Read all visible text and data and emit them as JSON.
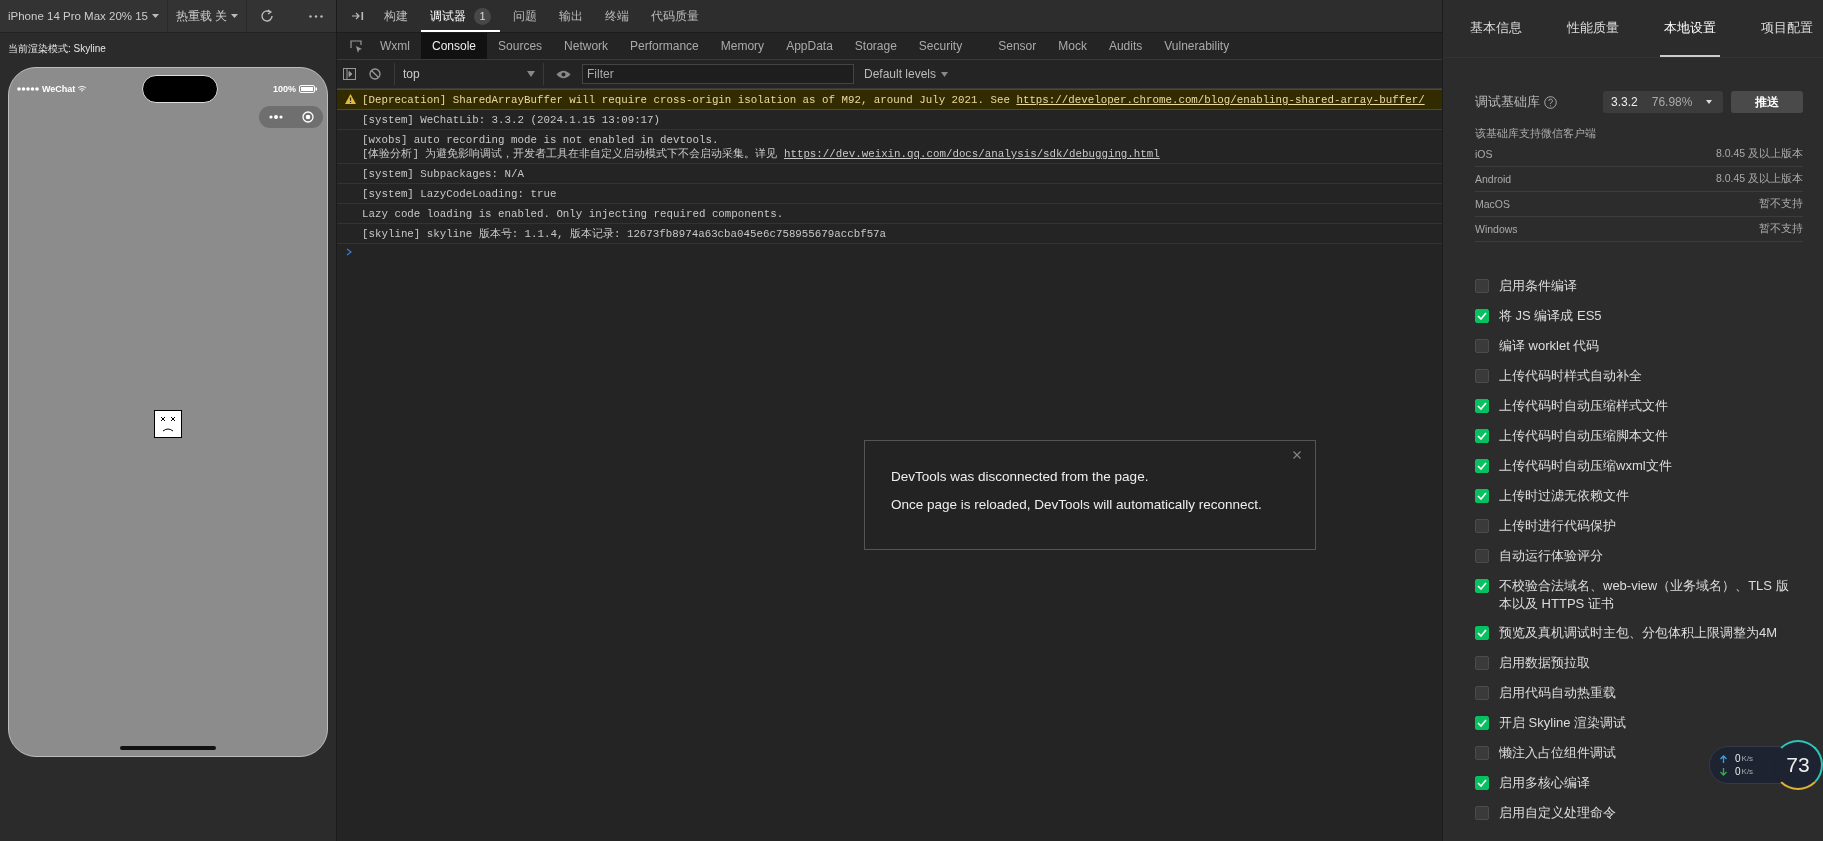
{
  "simulator": {
    "device_select": "iPhone 14 Pro Max 20% 15",
    "hot_reload_select": "热重载 关",
    "render_mode": "当前渲染模式: Skyline",
    "carrier": "WeChat",
    "battery": "100%"
  },
  "panel_tabs": [
    {
      "label": "构建",
      "selected": false
    },
    {
      "label": "调试器",
      "selected": true,
      "badge": "1"
    },
    {
      "label": "问题",
      "selected": false
    },
    {
      "label": "输出",
      "selected": false
    },
    {
      "label": "终端",
      "selected": false
    },
    {
      "label": "代码质量",
      "selected": false
    }
  ],
  "devtools_tabs": [
    {
      "label": "Wxml",
      "selected": false
    },
    {
      "label": "Console",
      "selected": true
    },
    {
      "label": "Sources",
      "selected": false
    },
    {
      "label": "Network",
      "selected": false
    },
    {
      "label": "Performance",
      "selected": false
    },
    {
      "label": "Memory",
      "selected": false
    },
    {
      "label": "AppData",
      "selected": false
    },
    {
      "label": "Storage",
      "selected": false
    },
    {
      "label": "Security",
      "selected": false
    },
    {
      "label": "Sensor",
      "selected": false
    },
    {
      "label": "Mock",
      "selected": false
    },
    {
      "label": "Audits",
      "selected": false
    },
    {
      "label": "Vulnerability",
      "selected": false
    }
  ],
  "console_toolbar": {
    "context": "top",
    "filter_placeholder": "Filter",
    "levels": "Default levels"
  },
  "console_messages": [
    {
      "kind": "warning",
      "lines": [
        {
          "text": "[Deprecation] SharedArrayBuffer will require cross-origin isolation as of M92, around July 2021. See",
          "link": "https://developer.chrome.com/blog/enabling-shared-array-buffer/"
        }
      ]
    },
    {
      "kind": "log",
      "lines": [
        {
          "text": "[system] WeChatLib: 3.3.2 (2024.1.15 13:09:17)"
        }
      ]
    },
    {
      "kind": "log",
      "lines": [
        {
          "text": "[wxobs] auto recording mode is not enabled in devtools."
        },
        {
          "text": "[体验分析] 为避免影响调试，开发者工具在非自定义启动模式下不会启动采集。详见",
          "link": "https://dev.weixin.qq.com/docs/analysis/sdk/debugging.html"
        }
      ]
    },
    {
      "kind": "log",
      "lines": [
        {
          "text": "[system] Subpackages: N/A"
        }
      ]
    },
    {
      "kind": "log",
      "lines": [
        {
          "text": "[system] LazyCodeLoading: true"
        }
      ]
    },
    {
      "kind": "log",
      "lines": [
        {
          "text": "Lazy code loading is enabled. Only injecting required components."
        }
      ]
    },
    {
      "kind": "log",
      "lines": [
        {
          "text": "[skyline] skyline 版本号: 1.1.4, 版本记录: 12673fb8974a63cba045e6c758955679accbf57a"
        }
      ]
    }
  ],
  "dialog": {
    "lines": [
      "DevTools was disconnected from the page.",
      "Once page is reloaded, DevTools will automatically reconnect."
    ]
  },
  "settings": {
    "tabs": [
      {
        "label": "基本信息",
        "selected": false
      },
      {
        "label": "性能质量",
        "selected": false
      },
      {
        "label": "本地设置",
        "selected": true
      },
      {
        "label": "项目配置",
        "selected": false
      }
    ],
    "library": {
      "label": "调试基础库",
      "version": "3.3.2",
      "share": "76.98%",
      "push_button": "推送"
    },
    "support_title": "该基础库支持微信客户端",
    "support": [
      {
        "platform": "iOS",
        "requirement": "8.0.45 及以上版本"
      },
      {
        "platform": "Android",
        "requirement": "8.0.45 及以上版本"
      },
      {
        "platform": "MacOS",
        "requirement": "暂不支持"
      },
      {
        "platform": "Windows",
        "requirement": "暂不支持"
      }
    ],
    "options": [
      {
        "label": "启用条件编译",
        "checked": false
      },
      {
        "label": "将 JS 编译成 ES5",
        "checked": true
      },
      {
        "label": "编译 worklet 代码",
        "checked": false
      },
      {
        "label": "上传代码时样式自动补全",
        "checked": false
      },
      {
        "label": "上传代码时自动压缩样式文件",
        "checked": true
      },
      {
        "label": "上传代码时自动压缩脚本文件",
        "checked": true
      },
      {
        "label": "上传代码时自动压缩wxml文件",
        "checked": true
      },
      {
        "label": "上传时过滤无依赖文件",
        "checked": true
      },
      {
        "label": "上传时进行代码保护",
        "checked": false
      },
      {
        "label": "自动运行体验评分",
        "checked": false
      },
      {
        "label": "不校验合法域名、web-view（业务域名）、TLS 版本以及 HTTPS 证书",
        "checked": true
      },
      {
        "label": "预览及真机调试时主包、分包体积上限调整为4M",
        "checked": true
      },
      {
        "label": "启用数据预拉取",
        "checked": false
      },
      {
        "label": "启用代码自动热重载",
        "checked": false
      },
      {
        "label": "开启 Skyline 渲染调试",
        "checked": true
      },
      {
        "label": "懒注入占位组件调试",
        "checked": false
      },
      {
        "label": "启用多核心编译",
        "checked": true
      },
      {
        "label": "启用自定义处理命令",
        "checked": false
      }
    ]
  },
  "network": {
    "upload": {
      "value": "0",
      "unit": "K/s"
    },
    "download": {
      "value": "0",
      "unit": "K/s"
    },
    "usage": "73"
  }
}
